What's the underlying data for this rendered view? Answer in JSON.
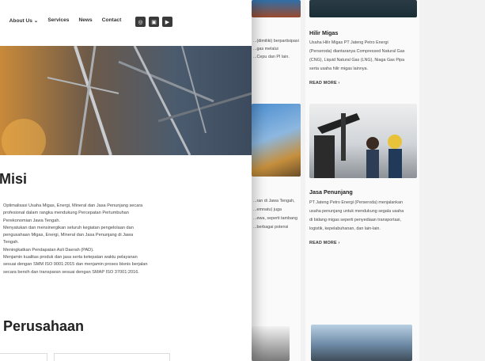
{
  "background": {
    "card_partial_text": [
      "...(dimiliki) berpartisipasi",
      "...gas melalui",
      "...Cepu dan PI lain."
    ],
    "hilir": {
      "title": "Hilir Migas",
      "lines": [
        "Usaha Hilir Migas PT Jateng Petro Energi",
        "(Perseroda) diantaranya Compressed Natural Gas",
        "(CNG), Liquid Natural Gas (LNG), Niaga Gas Pipa",
        "serta usaha hilir migas lainnya."
      ],
      "read_more": "READ MORE  ›"
    },
    "jasa": {
      "title": "Jasa Penunjang",
      "lines": [
        "PT Jateng Petro Energi (Perseroda) menjalankan",
        "usaha penunjang untuk mendukung segala usaha",
        "di bidang migas seperti penyediaan transportasi,",
        "logistik, kepelabuhanan, dan lain-lain."
      ],
      "read_more": "READ MORE  ›"
    },
    "left_partial": [
      "...ran di Jawa Tengah,",
      "...emnatu) juga",
      "...ewa, seperti tambang",
      "...berbagai potensi"
    ]
  },
  "front": {
    "nav": {
      "about": "About Us ⌄",
      "services": "Services",
      "news": "News",
      "contact": "Contact"
    },
    "social_icons": [
      "instagram-icon",
      "linkedin-icon",
      "youtube-icon"
    ],
    "misi_title": "Misi",
    "misi_list": [
      "Optimalisasi Usaha Migas, Energi, Mineral dan Jasa Penunjang secara",
      "profesional dalam rangka mendukung Percepatan Pertumbuhan",
      "Perekonomian Jawa Tengah.",
      "Menyatukan dan mensinergikan seluruh kegiatan pengelolaan dan",
      "pengusahaan Migas, Energi, Mineral dan Jasa Penunjang di Jawa",
      "Tengah.",
      "Meningkatkan Pendapatan Asli Daerah (PAD).",
      "Menjamin kualitas produk dan jasa serta ketepatan waktu pelayanan",
      "sesuai dengan SMM ISO 9001:2015 dan menjamin proses bisnis berjalan",
      "secara bersih dan transparan sesuai dengan SMAP ISO 37001:2016."
    ],
    "perusahaan_title": "Perusahaan"
  }
}
